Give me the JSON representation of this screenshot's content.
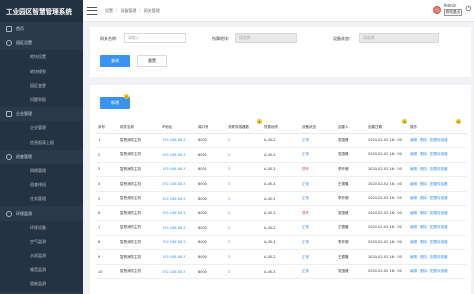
{
  "app": {
    "title": "工业园区智慧管理系统"
  },
  "sidebar": {
    "items": [
      {
        "label": "首页",
        "level": 0,
        "icon": "home-icon"
      },
      {
        "label": "园区设置",
        "level": 0,
        "icon": "settings-icon"
      },
      {
        "label": "地块设置",
        "level": 1
      },
      {
        "label": "地块规划",
        "level": 1
      },
      {
        "label": "园区变更",
        "level": 1
      },
      {
        "label": "问题举报",
        "level": 1
      },
      {
        "label": "企业管理",
        "level": 0,
        "icon": "building-icon"
      },
      {
        "label": "企业管理",
        "level": 1
      },
      {
        "label": "信息报表上报",
        "level": 1
      },
      {
        "label": "巡查管理",
        "level": 0,
        "icon": "patrol-icon"
      },
      {
        "label": "网格管理",
        "level": 1
      },
      {
        "label": "巡查排班",
        "level": 1
      },
      {
        "label": "任务管理",
        "level": 1
      },
      {
        "label": "环保监测",
        "level": 0,
        "icon": "env-icon"
      },
      {
        "label": "环保设备",
        "level": 1
      },
      {
        "label": "空气监测",
        "level": 1
      },
      {
        "label": "水质监测",
        "level": 1
      },
      {
        "label": "噪音监测",
        "level": 1
      },
      {
        "label": "固废监测",
        "level": 1
      },
      {
        "label": "应急管理",
        "level": 0,
        "icon": "emergency-icon"
      }
    ]
  },
  "header": {
    "breadcrumbs": [
      "设置",
      "/",
      "设备管理",
      "/",
      "网关管理"
    ],
    "username": "Admin",
    "logout": "修改退出"
  },
  "search": {
    "name_label": "网关名称:",
    "name_placeholder": "请输入",
    "region_label": "所属地块:",
    "region_placeholder": "请选择",
    "status_label": "设备状态:",
    "status_placeholder": "请选择",
    "query_button": "查询",
    "reset_button": "重置"
  },
  "list": {
    "add_button": "新增",
    "markers": [
      "7",
      "4",
      "5",
      "6"
    ],
    "headers": [
      "序号",
      "网关名称",
      "IP地址",
      "端口号",
      "关联传感器数",
      "所属地块",
      "设备状态",
      "创建人",
      "创建日期",
      "操作"
    ],
    "rows": [
      [
        "1",
        "智慧消防主机",
        "192.168.68.3",
        "8000",
        "3",
        "A-45-2",
        "正常",
        "张国峰",
        "2020-02-02 16：00",
        "ok"
      ],
      [
        "2",
        "智慧消防主机",
        "192.168.68.3",
        "8001",
        "3",
        "A-45-2",
        "正常",
        "张国峰",
        "2020-02-02 16：00",
        "ok"
      ],
      [
        "3",
        "智慧消防主机",
        "192.168.68.3",
        "8001",
        "3",
        "A-45-3",
        "损坏",
        "李开朗",
        "2020-02-02 16：00",
        "bad"
      ],
      [
        "4",
        "智慧消防主机",
        "192.168.68.3",
        "8000",
        "3",
        "A-45-4",
        "正常",
        "王德隆",
        "2020-02-02 16：00",
        "ok"
      ],
      [
        "5",
        "智慧消防主机",
        "192.168.68.3",
        "8000",
        "3",
        "A-45-2",
        "正常",
        "李开朗",
        "2020-02-02 16：00",
        "ok"
      ],
      [
        "6",
        "智慧消防主机",
        "192.168.68.3",
        "8000",
        "3",
        "A-45-2",
        "损坏",
        "张国峰",
        "2020-02-02 16：00",
        "bad"
      ],
      [
        "7",
        "智慧消防主机",
        "192.168.68.3",
        "8000",
        "3",
        "A-45-2",
        "正常",
        "王德隆",
        "2020-02-02 16：00",
        "ok"
      ],
      [
        "8",
        "智慧消防主机",
        "192.168.68.3",
        "8000",
        "3",
        "A-45-4",
        "正常",
        "李开朗",
        "2020-02-02 16：00",
        "ok"
      ],
      [
        "9",
        "智慧消防主机",
        "192.168.68.3",
        "8000",
        "3",
        "A-45-2",
        "正常",
        "王德隆",
        "2020-02-02 16：00",
        "ok"
      ],
      [
        "10",
        "智慧消防主机",
        "192.168.68.3",
        "8000",
        "3",
        "A-45-3",
        "正常",
        "张国峰",
        "2020-02-02 16：00",
        "ok"
      ]
    ],
    "ops": [
      "编辑",
      "删除",
      "配置传感器"
    ]
  },
  "colors": {
    "sidebar": "#2b3a4a",
    "accent": "#3b93f0",
    "danger": "#e04545",
    "marker": "#f5c518"
  }
}
